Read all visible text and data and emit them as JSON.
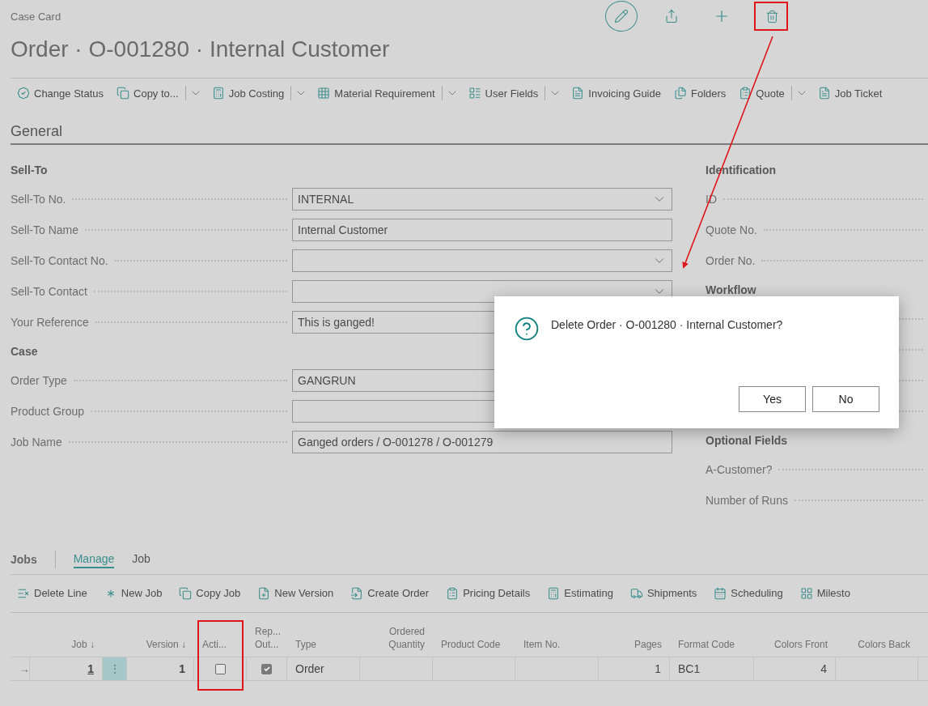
{
  "page": {
    "caption": "Case Card",
    "title": "Order · O-001280 · Internal Customer"
  },
  "actions": [
    {
      "label": "Change Status",
      "has_menu": false
    },
    {
      "label": "Copy to...",
      "has_menu": true
    },
    {
      "label": "Job Costing",
      "has_menu": true
    },
    {
      "label": "Material Requirement",
      "has_menu": true
    },
    {
      "label": "User Fields",
      "has_menu": true
    },
    {
      "label": "Invoicing Guide",
      "has_menu": false
    },
    {
      "label": "Folders",
      "has_menu": false
    },
    {
      "label": "Quote",
      "has_menu": true
    },
    {
      "label": "Job Ticket",
      "has_menu": false
    }
  ],
  "general": {
    "heading": "General",
    "left_groups": [
      {
        "heading": "Sell-To",
        "fields": [
          {
            "label": "Sell-To No.",
            "value": "INTERNAL",
            "kind": "dropdown"
          },
          {
            "label": "Sell-To Name",
            "value": "Internal Customer",
            "kind": "text"
          },
          {
            "label": "Sell-To Contact No.",
            "kind": "dropdown"
          },
          {
            "label": "Sell-To Contact",
            "kind": "dropdown"
          },
          {
            "label": "Your Reference",
            "value": "This is ganged!",
            "kind": "text"
          }
        ]
      },
      {
        "heading": "Case",
        "fields": [
          {
            "label": "Order Type",
            "value": "GANGRUN",
            "kind": "text"
          },
          {
            "label": "Product Group",
            "kind": "text"
          },
          {
            "label": "Job Name",
            "value": "Ganged orders / O-001278 / O-001279",
            "kind": "text"
          }
        ]
      }
    ],
    "right_groups": [
      {
        "heading": "Identification",
        "fields": [
          {
            "label": "ID"
          },
          {
            "label": "Quote No."
          },
          {
            "label": "Order No."
          }
        ]
      },
      {
        "heading": "Workflow"
      },
      {
        "heading": "Optional Fields",
        "fields": [
          {
            "label": "A-Customer?"
          },
          {
            "label": "Number of Runs"
          }
        ]
      }
    ]
  },
  "dialog": {
    "message": "Delete Order · O-001280 · Internal Customer?",
    "buttons": [
      "Yes",
      "No"
    ]
  },
  "jobs": {
    "heading": "Jobs",
    "tabs": [
      {
        "label": "Manage",
        "selected": true
      },
      {
        "label": "Job",
        "selected": false
      }
    ],
    "actions": [
      "Delete Line",
      "New Job",
      "Copy Job",
      "New Version",
      "Create Order",
      "Pricing Details",
      "Estimating",
      "Shipments",
      "Scheduling",
      "Milesto"
    ],
    "columns": [
      "Job ↓",
      "Version ↓",
      "Acti...",
      "Rep... Out...",
      "Type",
      "Ordered Quantity",
      "Product Code",
      "Item No.",
      "Pages",
      "Format Code",
      "Colors Front",
      "Colors Back"
    ],
    "rows": [
      {
        "marker": "→",
        "job": "1",
        "menu": "⋮",
        "version": "1",
        "active": false,
        "report_output": true,
        "type": "Order",
        "pages": "1",
        "format_code": "BC1",
        "colors_front": "4"
      }
    ]
  }
}
